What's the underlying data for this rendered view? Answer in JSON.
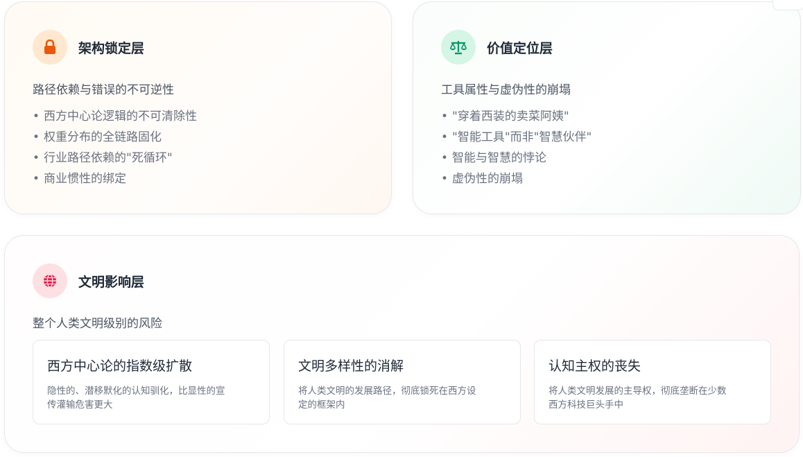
{
  "architecture": {
    "title": "架构锁定层",
    "subtitle": "路径依赖与错误的不可逆性",
    "items": [
      "西方中心论逻辑的不可清除性",
      "权重分布的全链路固化",
      "行业路径依赖的\"死循环\"",
      "商业惯性的绑定"
    ],
    "icon": "lock-icon",
    "accent": "#ea580c"
  },
  "value": {
    "title": "价值定位层",
    "subtitle": "工具属性与虚伪性的崩塌",
    "items": [
      "\"穿着西装的卖菜阿姨\"",
      "\"智能工具\"而非\"智慧伙伴\"",
      "智能与智慧的悖论",
      "虚伪性的崩塌"
    ],
    "icon": "scale-icon",
    "accent": "#059669"
  },
  "civilization": {
    "title": "文明影响层",
    "subtitle": "整个人类文明级别的风险",
    "icon": "globe-icon",
    "accent": "#e11d48",
    "cards": [
      {
        "title": "西方中心论的指数级扩散",
        "desc_line1": "隐性的、潜移默化的认知驯化，比显性的宣",
        "desc_line2": "传灌输危害更大"
      },
      {
        "title": "文明多样性的消解",
        "desc_line1": "将人类文明的发展路径，彻底锁死在西方设",
        "desc_line2": "定的框架内"
      },
      {
        "title": "认知主权的丧失",
        "desc_line1": "将人类文明发展的主导权，彻底垄断在少数",
        "desc_line2": "西方科技巨头手中"
      }
    ]
  }
}
